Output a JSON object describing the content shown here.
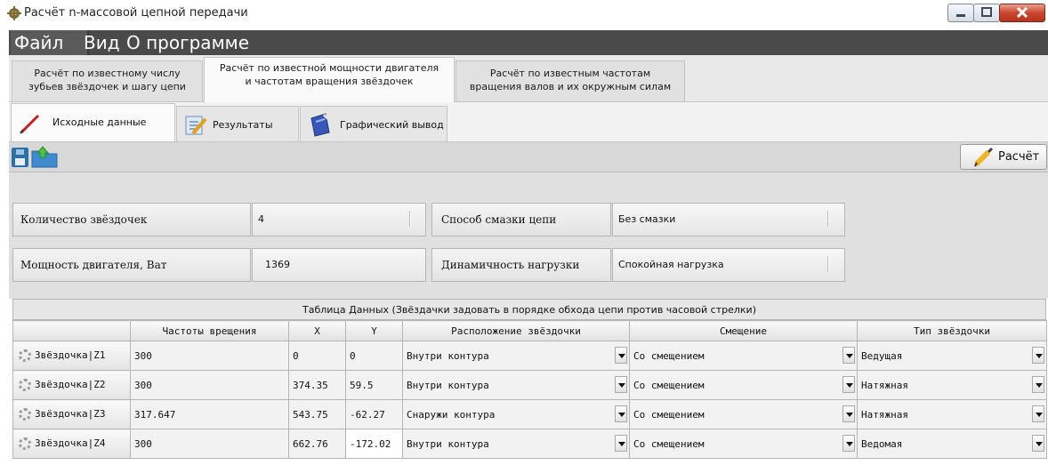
{
  "window": {
    "title": "Расчёт n-массовой цепной передачи"
  },
  "menu": {
    "items": [
      "Файл",
      "Вид",
      "О программе"
    ]
  },
  "tabs": [
    {
      "line1": "Расчёт по известному числу",
      "line2": "зубьев звёздочек и шагу цепи"
    },
    {
      "line1": "Расчёт по известной мощности двигателя",
      "line2": "и частотам вращения звёздочек"
    },
    {
      "line1": "Расчёт по известным частотам",
      "line2": "вращения валов и их окружным силам"
    }
  ],
  "subtabs": [
    "Исходные данные",
    "Результаты",
    "Графический вывод"
  ],
  "toolbar": {
    "calc_label": "Расчёт"
  },
  "params": {
    "count_label": "Количество звёздочек",
    "count_value": "4",
    "power_label": "Мощность двигателя, Ват",
    "power_value": "1369",
    "lube_label": "Способ смазки цепи",
    "lube_value": "Без смазки",
    "dyn_label": "Динамичность нагрузки",
    "dyn_value": "Спокойная нагрузка"
  },
  "table": {
    "caption": "Таблица Данных (Звёздачки задовать в порядке обхода цепи против часовой стрелки)",
    "headers": [
      "Частоты врещения",
      "X",
      "Y",
      "Расположение звёздочки",
      "Смещение",
      "Тип звёздочки"
    ],
    "rows": [
      {
        "name": "Звёздочка|Z1",
        "freq": "300",
        "x": "0",
        "y": "0",
        "pos": "Внутри контура",
        "offset": "Со смещением",
        "type": "Ведущая"
      },
      {
        "name": "Звёздочка|Z2",
        "freq": "300",
        "x": "374.35",
        "y": "59.5",
        "pos": "Внутри контура",
        "offset": "Со смещением",
        "type": "Натяжная"
      },
      {
        "name": "Звёздочка|Z3",
        "freq": "317.647",
        "x": "543.75",
        "y": "-62.27",
        "pos": "Снаружи контура",
        "offset": "Со смещением",
        "type": "Натяжная"
      },
      {
        "name": "Звёздочка|Z4",
        "freq": "300",
        "x": "662.76",
        "y": "-172.02",
        "pos": "Внутри контура",
        "offset": "Со смещением",
        "type": "Ведомая"
      }
    ]
  }
}
